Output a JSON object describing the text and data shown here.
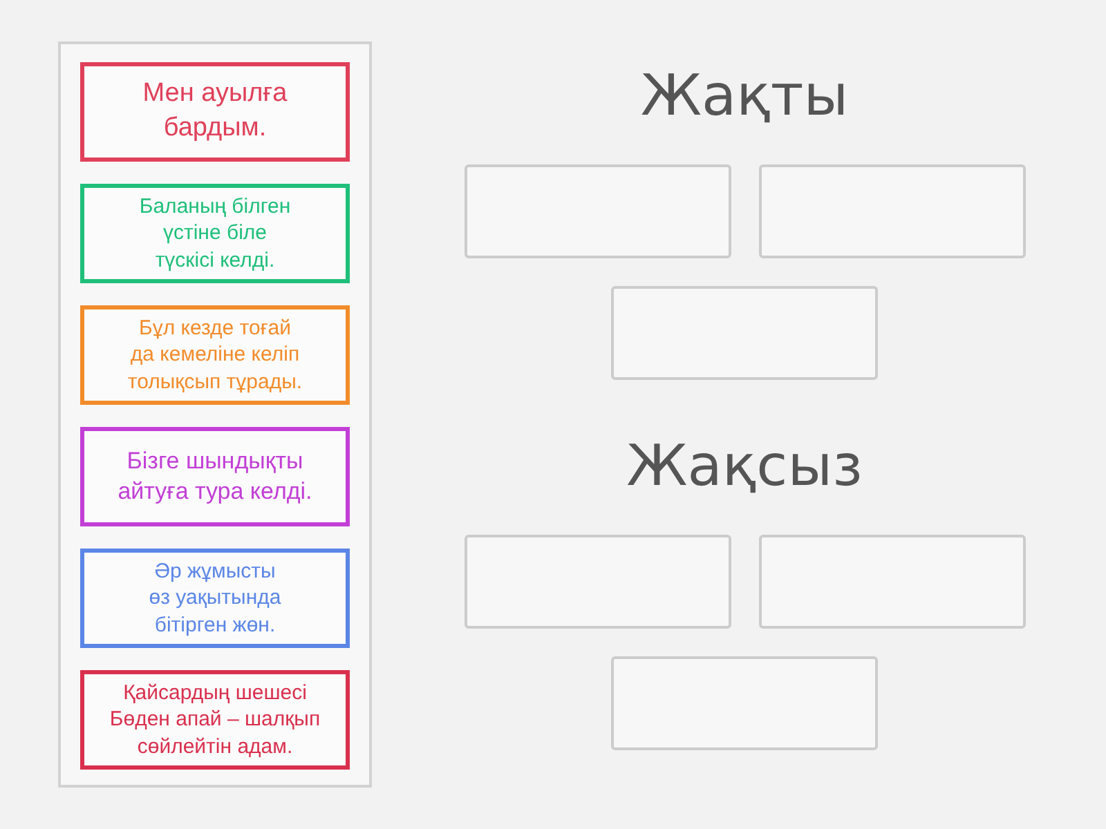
{
  "items": [
    {
      "text": "Мен ауылға бардым.",
      "color": "#e0405a"
    },
    {
      "text": "Баланың білген үстіне біле түскісі келді.",
      "color": "#1fbf7a"
    },
    {
      "text": "Бұл кезде тоғай да кемеліне келіп толықсып тұрады.",
      "color": "#f28c2b"
    },
    {
      "text": "Бізге шындықты айтуға тура келді.",
      "color": "#c23fd6"
    },
    {
      "text": "Әр жұмысты өз уақытында бітірген жөн.",
      "color": "#5b86e6"
    },
    {
      "text": "Қайсардың шешесі Бөден апай – шалқып сөйлейтін адам.",
      "color": "#d9304e"
    }
  ],
  "groups": [
    {
      "title": "Жақты",
      "slots": [
        {
          "kind": "empty"
        },
        {
          "kind": "empty"
        },
        {
          "kind": "empty"
        }
      ]
    },
    {
      "title": "Жақсыз",
      "slots": [
        {
          "kind": "empty"
        },
        {
          "kind": "empty"
        },
        {
          "kind": "empty"
        }
      ]
    }
  ]
}
